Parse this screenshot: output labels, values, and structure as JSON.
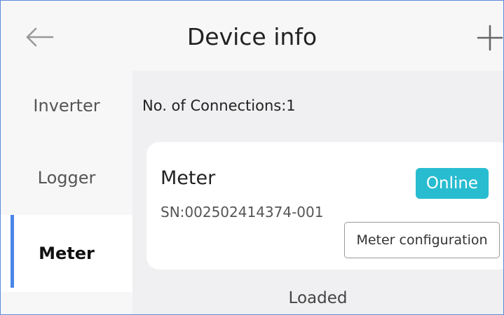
{
  "header": {
    "title": "Device info",
    "back_icon": "arrow-left-icon",
    "add_icon": "plus-icon"
  },
  "sidebar": {
    "items": [
      {
        "label": "Inverter"
      },
      {
        "label": "Logger"
      },
      {
        "label": "Meter",
        "active": true
      }
    ]
  },
  "main": {
    "connections_label": "No. of Connections:1",
    "device": {
      "name": "Meter",
      "serial": "SN:002502414374-001",
      "status": "Online",
      "config_button": "Meter configuration"
    },
    "footer_status": "Loaded"
  },
  "colors": {
    "accent": "#4a86e8",
    "online": "#28bcd0"
  }
}
